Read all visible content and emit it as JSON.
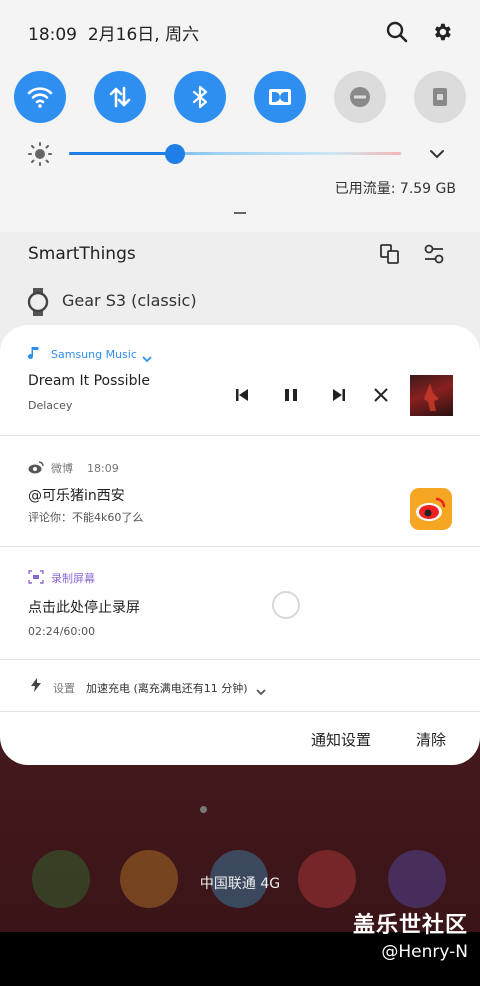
{
  "status": {
    "time": "18:09",
    "date": "2月16日, 周六"
  },
  "quick_toggles": [
    {
      "name": "wifi",
      "on": true
    },
    {
      "name": "mobile-data",
      "on": true
    },
    {
      "name": "bluetooth",
      "on": true
    },
    {
      "name": "dolby",
      "on": true
    },
    {
      "name": "do-not-disturb",
      "on": false
    },
    {
      "name": "screen-lock",
      "on": false
    }
  ],
  "brightness": {
    "level": 0.32
  },
  "data_usage": "已用流量: 7.59 GB",
  "devices": {
    "smartthings_label": "SmartThings",
    "gear_label": "Gear S3 (classic)"
  },
  "music": {
    "app": "Samsung Music",
    "track": "Dream It Possible",
    "artist": "Delacey"
  },
  "weibo": {
    "app": "微博",
    "time": "18:09",
    "title": "@可乐猪in西安",
    "text": "评论你：不能4k60了么"
  },
  "recorder": {
    "app": "录制屏幕",
    "title": "点击此处停止录屏",
    "duration": "02:24/60:00"
  },
  "charging": {
    "app": "设置",
    "text": "加速充电 (离充满电还有11 分钟)"
  },
  "actions": {
    "settings": "通知设置",
    "clear": "清除"
  },
  "carrier": "中国联通 4G",
  "watermark": {
    "site": "盖乐世社区",
    "user": "@Henry-N"
  },
  "colors": {
    "accent": "#2f8ff0",
    "weibo": "#f5a623"
  }
}
